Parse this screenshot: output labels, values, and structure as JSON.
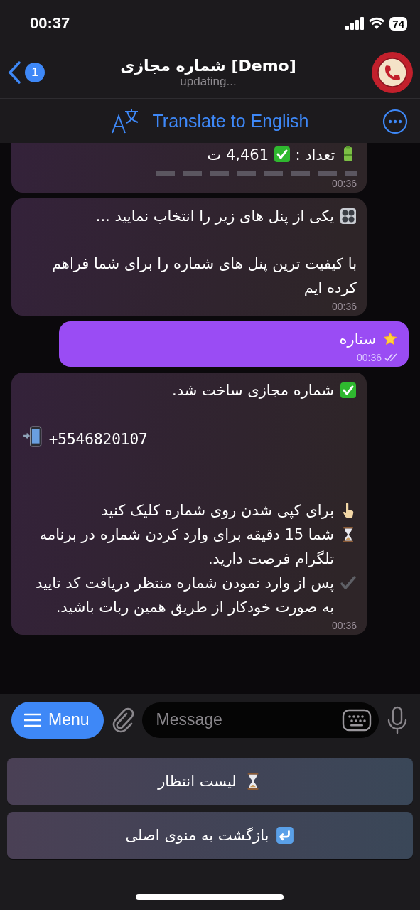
{
  "status_bar": {
    "time": "00:37",
    "battery": "74"
  },
  "header": {
    "back_badge": "1",
    "title": "شماره مجازی [Demo]",
    "subtitle": "updating..."
  },
  "translate_bar": {
    "label": "Translate to English"
  },
  "messages": [
    {
      "kind": "incoming",
      "lines": [
        {
          "kind": "count",
          "label": "تعداد :",
          "value": "4,461 ت"
        },
        {
          "kind": "dashes"
        }
      ],
      "time": "00:36"
    },
    {
      "kind": "incoming",
      "lines": [
        {
          "kind": "panel",
          "text": "یکی از پنل های زیر را انتخاب نمایید ..."
        },
        {
          "kind": "gap"
        },
        {
          "kind": "plain",
          "text": "با کیفیت ترین پنل های شماره را برای شما فراهم کرده ایم"
        }
      ],
      "time": "00:36"
    },
    {
      "kind": "outgoing",
      "lines": [
        {
          "kind": "star",
          "text": "ستاره"
        }
      ],
      "time": "00:36",
      "read": true
    },
    {
      "kind": "incoming",
      "lines": [
        {
          "kind": "check",
          "text": "شماره مجازی ساخت شد."
        },
        {
          "kind": "gap"
        },
        {
          "kind": "phone",
          "text": "+5546820107"
        },
        {
          "kind": "gap"
        },
        {
          "kind": "gap"
        },
        {
          "kind": "pointer",
          "text": "برای کپی شدن روی شماره کلیک کنید"
        },
        {
          "kind": "hourglass",
          "text": "شما 15 دقیقه برای وارد کردن شماره در برنامه  تلگرام فرصت دارید."
        },
        {
          "kind": "tick",
          "text": "پس از وارد نمودن شماره منتظر دریافت کد تایید به صورت خودکار از طریق همین ربات باشید."
        }
      ],
      "time": "00:36"
    }
  ],
  "composer": {
    "menu_label": "Menu",
    "placeholder": "Message"
  },
  "keyboard": [
    {
      "kind": "hourglass",
      "text": "لیست انتظار"
    },
    {
      "kind": "return",
      "text": "بازگشت به منوی اصلی"
    }
  ]
}
